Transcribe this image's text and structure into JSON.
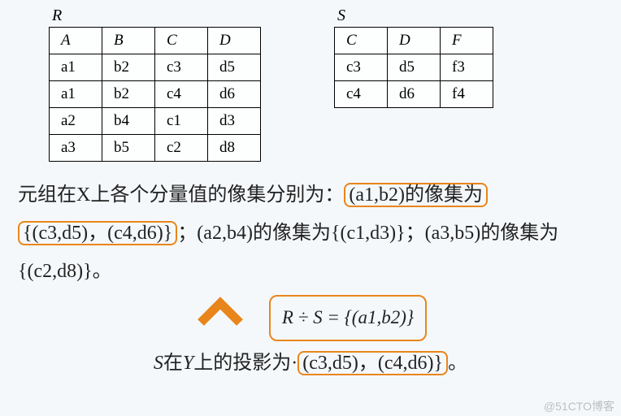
{
  "tables": {
    "R": {
      "name": "R",
      "headers": [
        "A",
        "B",
        "C",
        "D"
      ],
      "rows": [
        [
          "a1",
          "b2",
          "c3",
          "d5"
        ],
        [
          "a1",
          "b2",
          "c4",
          "d6"
        ],
        [
          "a2",
          "b4",
          "c1",
          "d3"
        ],
        [
          "a3",
          "b5",
          "c2",
          "d8"
        ]
      ]
    },
    "S": {
      "name": "S",
      "headers": [
        "C",
        "D",
        "F"
      ],
      "rows": [
        [
          "c3",
          "d5",
          "f3"
        ],
        [
          "c4",
          "d6",
          "f4"
        ]
      ]
    }
  },
  "text": {
    "p1_pre": "元组在X上各个分量值的像集分别为：",
    "p1_h1": "(a1,b2)的像集为",
    "p1_h2": "{(c3,d5)，(c4,d6)}",
    "p1_mid": "；(a2,b4)的像集为{(c1,d3)}；(a3,b5)的像集为{(c2,d8)}。",
    "result": "R ÷ S = {(a1,b2)}",
    "p3_pre_i": "S",
    "p3_pre_t": "在",
    "p3_pre_i2": "Y",
    "p3_pre_t2": "上的投影为·",
    "p3_h": "(c3,d5)，(c4,d6)}",
    "p3_post": "。"
  },
  "watermark": "@51CTO博客"
}
